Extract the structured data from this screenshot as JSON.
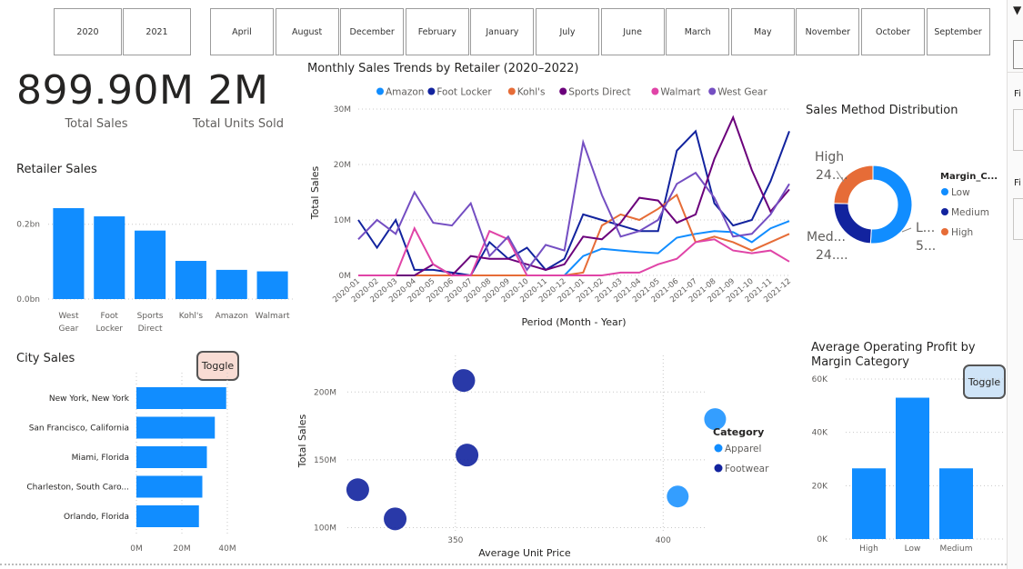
{
  "year_slicer": [
    "2020",
    "2021"
  ],
  "month_slicer": [
    "April",
    "August",
    "December",
    "February",
    "January",
    "July",
    "June",
    "March",
    "May",
    "November",
    "October",
    "September"
  ],
  "kpis": [
    {
      "value": "899.90M",
      "label": "Total Sales"
    },
    {
      "value": "2M",
      "label": "Total Units Sold"
    }
  ],
  "toggle_label": "Toggle",
  "right_pane": {
    "labels": [
      "Fi",
      "Fi"
    ]
  },
  "colors": {
    "accent": "#118dff",
    "amazon": "#118dff",
    "foot_locker": "#12239e",
    "kohls": "#e66c37",
    "sports_direct": "#6b007b",
    "walmart": "#e044a7",
    "west_gear": "#744ec2",
    "toggle_pink": "#f8dcd4",
    "toggle_blue": "#cfe4f7"
  },
  "retailer_sales": {
    "title": "Retailer Sales",
    "chart_data": {
      "type": "bar",
      "categories": [
        "West Gear",
        "Foot Locker",
        "Sports Direct",
        "Kohl's",
        "Amazon",
        "Walmart"
      ],
      "category_lines": [
        [
          "West",
          "Gear"
        ],
        [
          "Foot",
          "Locker"
        ],
        [
          "Sports",
          "Direct"
        ],
        [
          "Kohl's"
        ],
        [
          "Amazon"
        ],
        [
          "Walmart"
        ]
      ],
      "values": [
        0.243,
        0.221,
        0.183,
        0.102,
        0.078,
        0.074
      ],
      "y_ticks": [
        {
          "v": 0,
          "label": "0.0bn"
        },
        {
          "v": 0.2,
          "label": "0.2bn"
        }
      ],
      "ylim": [
        0,
        0.26
      ]
    }
  },
  "line_chart": {
    "title": "Monthly Sales Trends by Retailer (2020–2022)",
    "chart_data": {
      "type": "line",
      "xlabel": "Period (Month - Year)",
      "ylabel": "Total Sales",
      "ylim": [
        0,
        30
      ],
      "y_ticks": [
        {
          "v": 0,
          "label": "0M"
        },
        {
          "v": 10,
          "label": "10M"
        },
        {
          "v": 20,
          "label": "20M"
        },
        {
          "v": 30,
          "label": "30M"
        }
      ],
      "x": [
        "2020-01",
        "2020-02",
        "2020-03",
        "2020-04",
        "2020-05",
        "2020-06",
        "2020-07",
        "2020-08",
        "2020-09",
        "2020-10",
        "2020-11",
        "2020-12",
        "2021-01",
        "2021-02",
        "2021-03",
        "2021-04",
        "2021-05",
        "2021-06",
        "2021-07",
        "2021-08",
        "2021-09",
        "2021-10",
        "2021-11",
        "2021-12"
      ],
      "series": [
        {
          "name": "Amazon",
          "color": "#118dff",
          "values": [
            0,
            0,
            0,
            0,
            0,
            0,
            0,
            0,
            0,
            0,
            0,
            0,
            3.5,
            4.8,
            4.5,
            4.2,
            4.0,
            6.8,
            7.5,
            8.0,
            7.8,
            6.0,
            8.5,
            9.8
          ]
        },
        {
          "name": "Foot Locker",
          "color": "#12239e",
          "values": [
            10,
            5,
            10,
            1,
            1,
            0.5,
            0,
            6,
            3,
            5,
            1,
            3,
            11,
            10,
            9,
            8,
            8,
            22.5,
            26,
            13,
            9,
            10,
            17,
            26
          ]
        },
        {
          "name": "Kohl's",
          "color": "#e66c37",
          "values": [
            0,
            0,
            0,
            0,
            0,
            0,
            0,
            0,
            0,
            0,
            0,
            0,
            0.5,
            9,
            11,
            10,
            12,
            14.5,
            6,
            7,
            6,
            4.5,
            6,
            7.5
          ]
        },
        {
          "name": "Sports Direct",
          "color": "#6b007b",
          "values": [
            0,
            0,
            0,
            0,
            2,
            0,
            3.5,
            3,
            3,
            2,
            1,
            2,
            7,
            6.5,
            9.5,
            14,
            13.5,
            9.5,
            11,
            21,
            28.5,
            19,
            11.5,
            15.5
          ]
        },
        {
          "name": "Walmart",
          "color": "#e044a7",
          "values": [
            0,
            0,
            0,
            8.5,
            2,
            0,
            0,
            8,
            6.5,
            0,
            0,
            0,
            0,
            0,
            0.5,
            0.5,
            2,
            3,
            6,
            6.5,
            4.5,
            4,
            4.5,
            2.5
          ]
        },
        {
          "name": "West Gear",
          "color": "#744ec2",
          "values": [
            6.5,
            10,
            7.5,
            15,
            9.5,
            9,
            13,
            3.5,
            7,
            1,
            5.5,
            4.5,
            24,
            14.5,
            7,
            8,
            10,
            16.5,
            18.5,
            14,
            7,
            7.5,
            11,
            16.5
          ]
        }
      ]
    }
  },
  "donut": {
    "title": "Sales Method Distribution",
    "legend_title": "Margin_C...",
    "chart_data": {
      "type": "pie",
      "categories": [
        "Low",
        "Medium",
        "High"
      ],
      "colors": [
        "#118dff",
        "#12239e",
        "#e66c37"
      ],
      "values": [
        51,
        24.5,
        24.5
      ]
    },
    "labels": {
      "high": [
        "High",
        "24...."
      ],
      "medium": [
        "Med...",
        "24...."
      ],
      "low": [
        "L...",
        "5..."
      ]
    }
  },
  "city_sales": {
    "title": "City Sales",
    "chart_data": {
      "type": "bar",
      "categories": [
        "New York, New York",
        "San Francisco, California",
        "Miami, Florida",
        "Charleston, South Caro...",
        "Orlando, Florida"
      ],
      "values": [
        39.5,
        34.5,
        31.0,
        29.0,
        27.5
      ],
      "x_ticks": [
        {
          "v": 0,
          "label": "0M"
        },
        {
          "v": 20,
          "label": "20M"
        },
        {
          "v": 40,
          "label": "40M"
        }
      ],
      "xlim": [
        0,
        40
      ]
    }
  },
  "scatter": {
    "chart_data": {
      "type": "scatter",
      "xlabel": "Average Unit Price",
      "ylabel": "Total Sales",
      "xlim": [
        324,
        410
      ],
      "ylim": [
        97,
        227
      ],
      "x_ticks": [
        {
          "v": 350,
          "label": "350"
        },
        {
          "v": 400,
          "label": "400"
        }
      ],
      "y_ticks": [
        {
          "v": 100,
          "label": "100M"
        },
        {
          "v": 150,
          "label": "150M"
        },
        {
          "v": 200,
          "label": "200M"
        }
      ],
      "legend_title": "Category",
      "series": [
        {
          "name": "Apparel",
          "color": "#118dff",
          "points": [
            [
              412.5,
              180
            ],
            [
              403.5,
              123
            ]
          ]
        },
        {
          "name": "Footwear",
          "color": "#12239e",
          "points": [
            [
              352,
              208.5
            ],
            [
              352.8,
              153.5
            ],
            [
              326.5,
              128
            ],
            [
              335.5,
              106.5
            ]
          ]
        }
      ]
    }
  },
  "op_profit": {
    "title_lines": [
      "Average Operating Profit by",
      "Margin Category"
    ],
    "chart_data": {
      "type": "bar",
      "categories": [
        "High",
        "Low",
        "Medium"
      ],
      "values": [
        26.5,
        53,
        26.5
      ],
      "ylim": [
        0,
        60
      ],
      "y_ticks": [
        {
          "v": 0,
          "label": "0K"
        },
        {
          "v": 20,
          "label": "20K"
        },
        {
          "v": 40,
          "label": "40K"
        },
        {
          "v": 60,
          "label": "60K"
        }
      ]
    }
  }
}
